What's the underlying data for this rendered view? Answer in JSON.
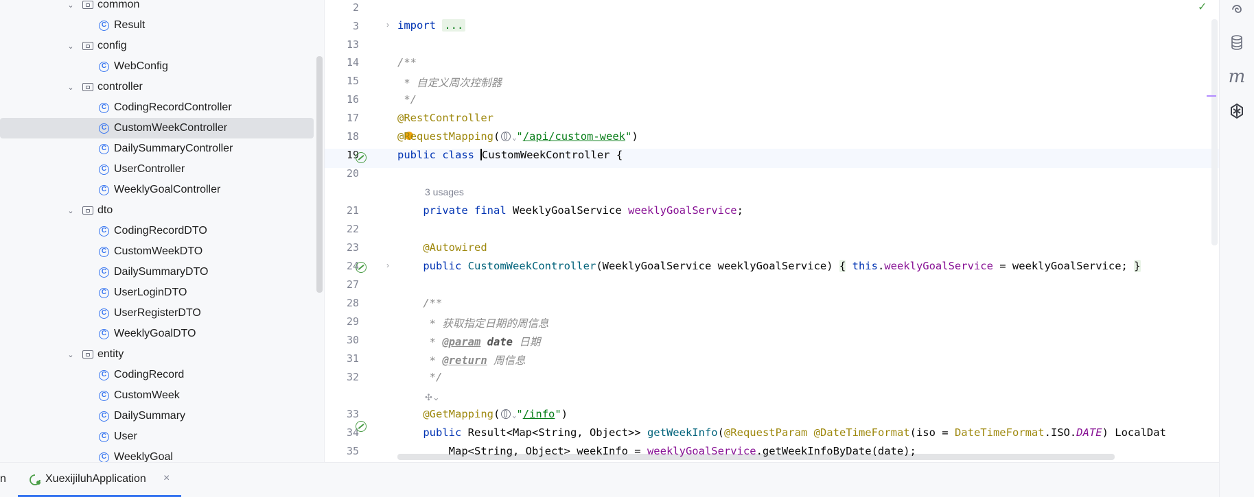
{
  "project_tree": {
    "rows": [
      {
        "type": "folder",
        "label": "common",
        "depth": 1
      },
      {
        "type": "class",
        "label": "Result",
        "depth": 2
      },
      {
        "type": "folder",
        "label": "config",
        "depth": 1
      },
      {
        "type": "class",
        "label": "WebConfig",
        "depth": 2
      },
      {
        "type": "folder",
        "label": "controller",
        "depth": 1
      },
      {
        "type": "class",
        "label": "CodingRecordController",
        "depth": 2
      },
      {
        "type": "class",
        "label": "CustomWeekController",
        "depth": 2,
        "selected": true
      },
      {
        "type": "class",
        "label": "DailySummaryController",
        "depth": 2
      },
      {
        "type": "class",
        "label": "UserController",
        "depth": 2
      },
      {
        "type": "class",
        "label": "WeeklyGoalController",
        "depth": 2
      },
      {
        "type": "folder",
        "label": "dto",
        "depth": 1
      },
      {
        "type": "class",
        "label": "CodingRecordDTO",
        "depth": 2
      },
      {
        "type": "class",
        "label": "CustomWeekDTO",
        "depth": 2
      },
      {
        "type": "class",
        "label": "DailySummaryDTO",
        "depth": 2
      },
      {
        "type": "class",
        "label": "UserLoginDTO",
        "depth": 2
      },
      {
        "type": "class",
        "label": "UserRegisterDTO",
        "depth": 2
      },
      {
        "type": "class",
        "label": "WeeklyGoalDTO",
        "depth": 2
      },
      {
        "type": "folder",
        "label": "entity",
        "depth": 1
      },
      {
        "type": "class",
        "label": "CodingRecord",
        "depth": 2
      },
      {
        "type": "class",
        "label": "CustomWeek",
        "depth": 2
      },
      {
        "type": "class",
        "label": "DailySummary",
        "depth": 2
      },
      {
        "type": "class",
        "label": "User",
        "depth": 2
      },
      {
        "type": "class",
        "label": "WeeklyGoal",
        "depth": 2
      }
    ],
    "class_icon_letter": "C"
  },
  "editor": {
    "current_line": "19",
    "line_numbers": [
      "2",
      "3",
      "13",
      "14",
      "15",
      "16",
      "17",
      "18",
      "19",
      "20",
      "21",
      "22",
      "23",
      "24",
      "27",
      "28",
      "29",
      "30",
      "31",
      "32",
      "33",
      "34",
      "35"
    ],
    "usages_hint": "3 usages",
    "code": {
      "import_kw": "import",
      "import_fold": "...",
      "doc_open": "/**",
      "doc_line_desc": " * 自定义周次控制器",
      "doc_close": " */",
      "ann_restcontroller": "@RestController",
      "ann_requestmapping": "@RequestMapping",
      "paren_open": "(",
      "paren_close": ")",
      "quote": "\"",
      "route_api": "/api/custom-week",
      "kw_public": "public",
      "kw_class": "class",
      "class_name": "CustomWeekController",
      "open_brace": " {",
      "kw_private": "private",
      "kw_final": "final",
      "type_service": "WeeklyGoalService",
      "field_service": "weeklyGoalService",
      "semicolon": ";",
      "ann_autowired": "@Autowired",
      "ctor_params": "(WeeklyGoalService weeklyGoalService) ",
      "brace_open": "{",
      "brace_close": "}",
      "kw_this": "this",
      "dot": ".",
      "assign_rest": " = weeklyGoalService;",
      "doc2_open": "/**",
      "doc2_desc": " * 获取指定日期的周信息",
      "star_prefix": " * ",
      "tag_param": "@param",
      "param_name": " date",
      "param_desc": " 日期",
      "tag_return": "@return",
      "return_desc": " 周信息",
      "doc2_close": " */",
      "ann_getmapping": "@GetMapping",
      "route_info": "/info",
      "ret_type": "Result<Map<String, Object>> ",
      "method_name": "getWeekInfo",
      "ann_requestparam": "@RequestParam",
      "ann_datetimeformat": "@DateTimeFormat",
      "iso_prefix": "(iso = ",
      "dtf_class": "DateTimeFormat",
      "iso_mid": ".ISO.",
      "iso_const": "DATE",
      "iso_suffix": ") LocalDat",
      "line35_prefix": "    Map<String, Object> weekInfo = ",
      "line35_call": ".getWeekInfoByDate(date);"
    }
  },
  "bottom": {
    "left_fragment": "n",
    "run_tab_label": "XuexijiluhApplication",
    "close_glyph": "×"
  },
  "right_strip": {
    "icons": [
      "ai-assistant-icon",
      "database-icon",
      "maven-icon",
      "plugin-icon"
    ],
    "maven_glyph": "m"
  },
  "colors": {
    "keyword": "#0033b3",
    "annotation": "#9e880d",
    "field": "#871094",
    "string": "#067d17",
    "method": "#00627a",
    "comment": "#8c8c8c",
    "selection": "#dfe1e5",
    "accent": "#3574f0"
  }
}
